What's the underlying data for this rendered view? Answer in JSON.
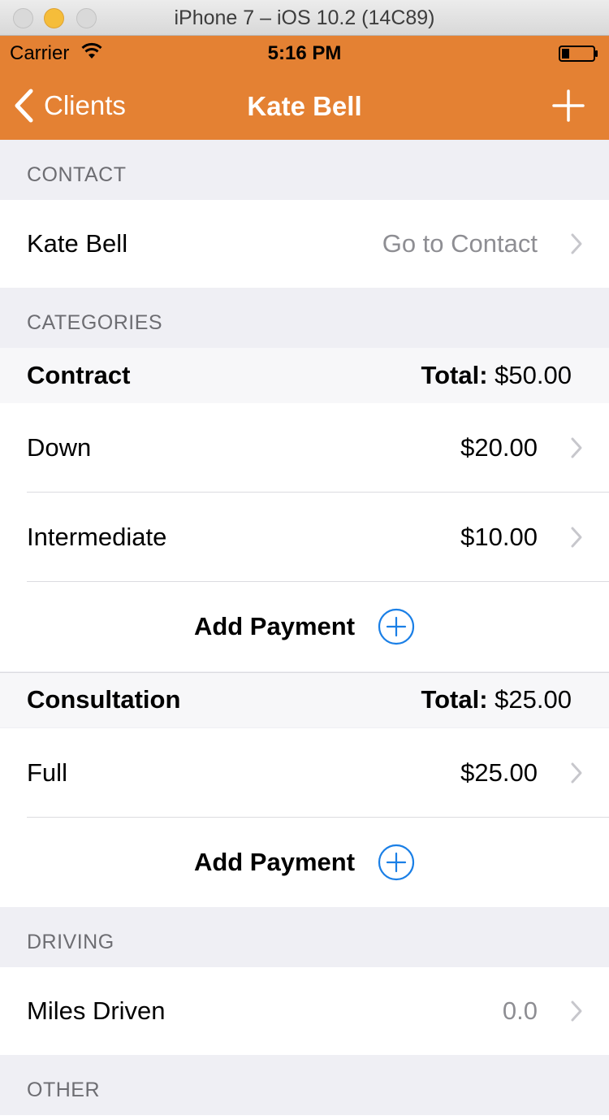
{
  "window": {
    "title": "iPhone 7 – iOS 10.2 (14C89)"
  },
  "status_bar": {
    "carrier": "Carrier",
    "time": "5:16 PM"
  },
  "nav": {
    "back_label": "Clients",
    "title": "Kate Bell"
  },
  "colors": {
    "accent": "#e48133",
    "link_blue": "#1a7fe6"
  },
  "sections": {
    "contact": {
      "header": "CONTACT",
      "row": {
        "label": "Kate Bell",
        "value": "Go to Contact"
      }
    },
    "categories": {
      "header": "CATEGORIES",
      "groups": [
        {
          "name": "Contract",
          "total_label": "Total:",
          "total_value": "$50.00",
          "payments": [
            {
              "label": "Down",
              "amount": "$20.00"
            },
            {
              "label": "Intermediate",
              "amount": "$10.00"
            }
          ],
          "add_label": "Add Payment"
        },
        {
          "name": "Consultation",
          "total_label": "Total:",
          "total_value": "$25.00",
          "payments": [
            {
              "label": "Full",
              "amount": "$25.00"
            }
          ],
          "add_label": "Add Payment"
        }
      ]
    },
    "driving": {
      "header": "DRIVING",
      "row": {
        "label": "Miles Driven",
        "value": "0.0"
      }
    },
    "other": {
      "header": "OTHER"
    }
  }
}
